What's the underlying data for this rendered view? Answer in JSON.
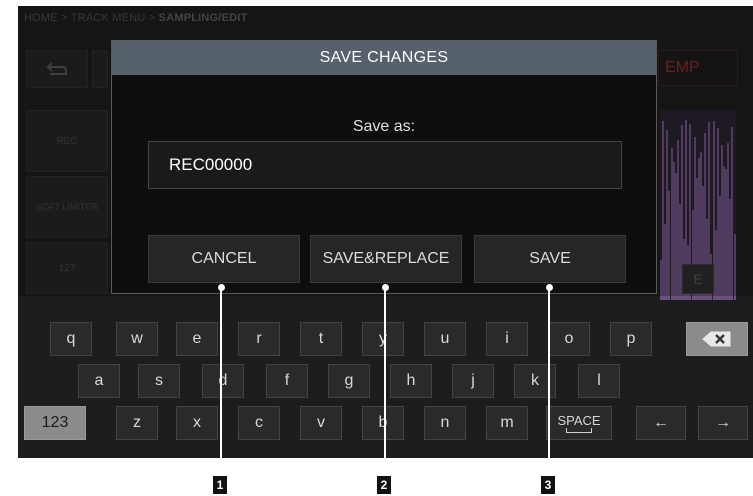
{
  "breadcrumb": {
    "home": "HOME",
    "sep": ">",
    "track_menu": "TRACK MENU",
    "current": "SAMPLING/EDIT"
  },
  "background": {
    "left_items": [
      "REC",
      "SOFT LIMITER",
      "127"
    ],
    "temp_label": "EMP",
    "tab_label": "E"
  },
  "dialog": {
    "title": "SAVE CHANGES",
    "prompt": "Save as:",
    "filename": "REC00000",
    "buttons": {
      "cancel": "CANCEL",
      "save_replace": "SAVE&REPLACE",
      "save": "SAVE"
    }
  },
  "keyboard": {
    "row1": [
      "q",
      "w",
      "e",
      "r",
      "t",
      "y",
      "u",
      "i",
      "o",
      "p"
    ],
    "row2": [
      "a",
      "s",
      "d",
      "f",
      "g",
      "h",
      "j",
      "k",
      "l"
    ],
    "row3": [
      "z",
      "x",
      "c",
      "v",
      "b",
      "n",
      "m"
    ],
    "mode_key": "123",
    "space_key": "SPACE",
    "backspace_icon": "backspace-icon",
    "left_arrow": "←",
    "right_arrow": "→"
  },
  "callouts": [
    "1",
    "2",
    "3"
  ]
}
